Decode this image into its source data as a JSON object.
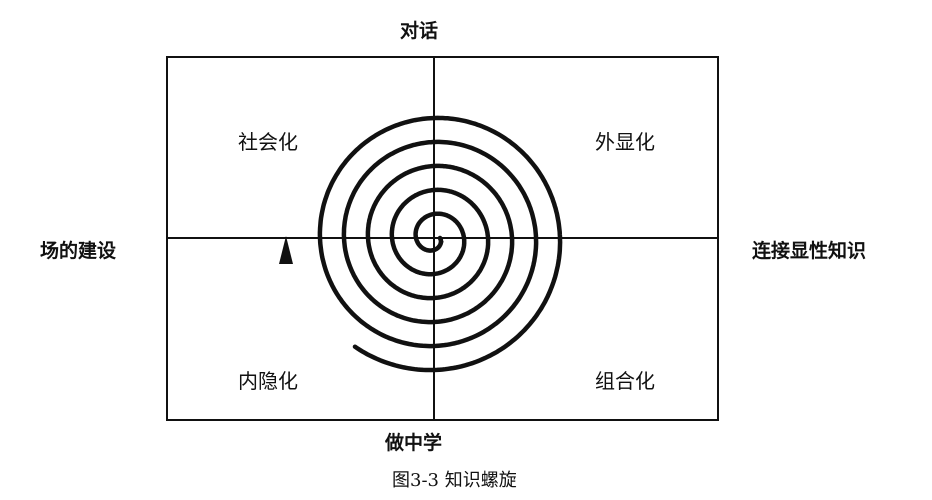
{
  "axes": {
    "top": "对话",
    "bottom": "做中学",
    "left": "场的建设",
    "right": "连接显性知识"
  },
  "quadrants": {
    "top_left": "社会化",
    "top_right": "外显化",
    "bottom_left": "内隐化",
    "bottom_right": "组合化"
  },
  "caption": "图3-3 知识螺旋"
}
